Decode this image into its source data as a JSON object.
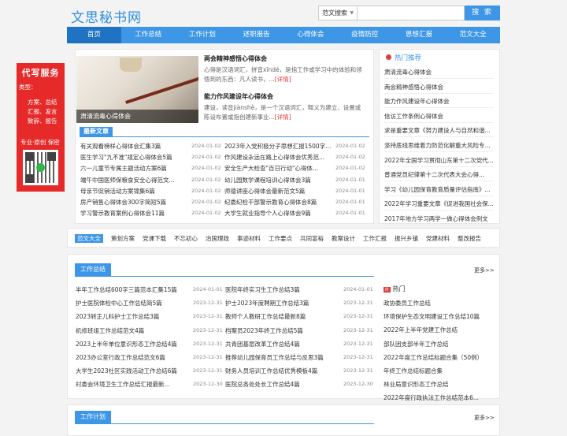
{
  "site": {
    "logo": "文思秘书网"
  },
  "search": {
    "select_value": "范文搜索",
    "placeholder": "",
    "button": "搜 索"
  },
  "nav": [
    "首页",
    "工作总结",
    "工作计划",
    "述职报告",
    "心得体会",
    "疫情防控",
    "思想汇报",
    "范文大全"
  ],
  "ad": {
    "title": "代写服务",
    "line1": "类型：",
    "line2": "方案、总结",
    "line3": "汇报、发言",
    "line4": "致辞、报告",
    "line5": "原创  保密",
    "line5_prefix": "专业·",
    "colors": {
      "bg": "#e62a2a"
    }
  },
  "hero": {
    "caption": "肃清流毒心得体会"
  },
  "headlines": [
    {
      "title": "两会精神感悟心得体会",
      "desc": "心得是汉语词汇，拼音xīndé，是指工作或学习中的体验和领悟到的东西：凡人读书，...",
      "more": "[详情]"
    },
    {
      "title": "能力作风建设年心得体会",
      "desc": "建设，读音jiànshè，是一个汉语词汇，释义为建立、设置或陈设布置或指创建新事业...",
      "more": "[详情]"
    }
  ],
  "latest": {
    "heading": "最新文章",
    "items": [
      {
        "t": "有关观看榜样心得体会汇集3篇",
        "d": "2024-01-02"
      },
      {
        "t": "2023年入党积极分子思想汇报1500字...",
        "d": "2024-01-02"
      },
      {
        "t": "医生学习\"九不准\"规定心得体会5篇",
        "d": "2024-01-02"
      },
      {
        "t": "作风建设永远在路上心得体会优秀范...",
        "d": "2024-01-02"
      },
      {
        "t": "六一儿童节专属主题活动方案6篇",
        "d": "2024-01-02"
      },
      {
        "t": "安全生产大检查\"百日行动\"心得体...",
        "d": "2024-01-02"
      },
      {
        "t": "端午中国医师保粮食安全心得范文...",
        "d": "2024-01-02"
      },
      {
        "t": "幼儿园数学课程培训心得体会3篇",
        "d": "2024-01-01"
      },
      {
        "t": "母亲节促销活动方案锦集6篇",
        "d": "2024-01-02"
      },
      {
        "t": "师德讲座心得体会最新范文5篇",
        "d": "2024-01-01"
      },
      {
        "t": "房产销售心得体会300字简短5篇",
        "d": "2024-01-02"
      },
      {
        "t": "纪委纪检干部警示教育心得体会8篇",
        "d": "2024-01-01"
      },
      {
        "t": "学习警示教育案例心得体会11篇",
        "d": "2024-01-02"
      },
      {
        "t": "大学生就业指导个人心得体会9篇",
        "d": "2024-01-01"
      }
    ]
  },
  "hot": {
    "heading": "热门推荐",
    "items": [
      "肃清流毒心得体会",
      "两会精神感悟心得体会",
      "能力作风建设年心得体会",
      "信访工作条例心得体会",
      "求是重要文章《努力建设人与自然和谐...",
      "坚持底线思维着力防范化解重大风险专...",
      "2022年全国学习贯彻山东第十二次党代...",
      "普通党员纪律第十二次代表大会心得...",
      "学习《幼儿园保育教育质量评估指南》...",
      "2022年学习重要文章《促进我国社会保...",
      "2017年地方学习两学一做心得体会例文"
    ]
  },
  "tags": [
    "范文大全",
    "策划方案",
    "党课下载",
    "不忘初心",
    "治国理政",
    "事迹材料",
    "工作要点",
    "共同富裕",
    "教案设计",
    "工作汇报",
    "振兴乡镇",
    "党建材料",
    "整改报告"
  ],
  "section1": {
    "title": "工作总结",
    "more": "更多>>",
    "hot_label": "热门",
    "hot_badge": "H",
    "col1": [
      {
        "t": "半年工作总结600字三篇范本汇集15篇",
        "d": "2024-01-01"
      },
      {
        "t": "护士医院体检中心工作总结简5篇",
        "d": "2023-12-31"
      },
      {
        "t": "2023转正儿科护士工作总结3篇",
        "d": "2023-12-31"
      },
      {
        "t": "机修班组工作总结范文4篇",
        "d": "2023-12-31"
      },
      {
        "t": "2023上半年单位意识形态工作总结4篇",
        "d": "2023-12-31"
      },
      {
        "t": "2023办公室行政工作总结范文6篇",
        "d": "2023-12-31"
      },
      {
        "t": "大学生2023社区实践活动工作总结6篇",
        "d": "2023-12-31"
      },
      {
        "t": "村委会环境卫生工作总结汇报最新...",
        "d": "2023-12-30"
      }
    ],
    "col2": [
      {
        "t": "医院年终实习生工作总结3篇",
        "d": "2024-01-01"
      },
      {
        "t": "护士2023年度聘期工作总结3篇",
        "d": "2023-12-31"
      },
      {
        "t": "教师个人教研工作总结最新8篇",
        "d": "2023-12-31"
      },
      {
        "t": "档案员2023年终工作总结5篇",
        "d": "2023-12-31"
      },
      {
        "t": "共青团基层改革工作总结4篇",
        "d": "2023-12-31"
      },
      {
        "t": "推荐幼儿园保育员工作总结与反思3篇",
        "d": "2023-12-31"
      },
      {
        "t": "财务人员培训工作总结优秀模板4篇",
        "d": "2023-12-31"
      },
      {
        "t": "医院总务处处长工作总结4篇",
        "d": "2023-12-30"
      }
    ],
    "hot_items": [
      "政协委员工作总结",
      "环境保护生态文明建设工作总结10篇",
      "2022年上半年党建工作总结",
      "部队团支部半年工作总结",
      "2022年度工作总结标题合集（50例）",
      "年终工作总结标题合集",
      "林业局意识形态工作总结",
      "2022年度行政执法工作总结范本6..."
    ]
  },
  "section2": {
    "title": "工作计划",
    "more": "更多>>"
  },
  "colors": {
    "accent": "#3d96e6",
    "nav_active": "#1f73c2",
    "red": "#e03a3a"
  }
}
